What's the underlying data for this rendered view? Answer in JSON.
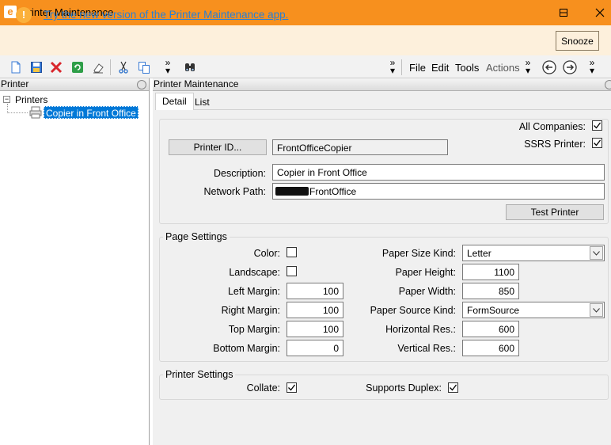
{
  "window": {
    "title": "Printer Maintenance",
    "logo": "e"
  },
  "banner": {
    "link_text": "Try the new version of the Printer Maintenance app.",
    "snooze_label": "Snooze"
  },
  "toolbar": {
    "menus": [
      "File",
      "Edit",
      "Tools",
      "Actions"
    ],
    "icons": [
      "new-icon",
      "save-icon",
      "delete-icon",
      "refresh-icon",
      "clear-icon",
      "cut-icon",
      "copy-icon",
      "more-icon",
      "binoculars-icon",
      "back-icon",
      "forward-icon"
    ]
  },
  "left_pane": {
    "header": "Printer",
    "tree": {
      "root": "Printers",
      "children": [
        "Copier in Front Office"
      ]
    }
  },
  "right_pane": {
    "header": "Printer Maintenance",
    "tabs": [
      "Detail",
      "List"
    ],
    "active_tab": "Detail"
  },
  "detail": {
    "all_companies_label": "All Companies:",
    "all_companies": true,
    "ssrs_label": "SSRS Printer:",
    "ssrs": true,
    "printer_id_button": "Printer ID...",
    "printer_id_value": "FrontOfficeCopier",
    "description_label": "Description:",
    "description_value": "Copier in Front Office",
    "network_path_label": "Network Path:",
    "network_path_value": "FrontOffice",
    "test_printer_button": "Test Printer"
  },
  "page_settings": {
    "title": "Page Settings",
    "color_label": "Color:",
    "color": false,
    "landscape_label": "Landscape:",
    "landscape": false,
    "left_margin_label": "Left Margin:",
    "left_margin": "100",
    "right_margin_label": "Right Margin:",
    "right_margin": "100",
    "top_margin_label": "Top Margin:",
    "top_margin": "100",
    "bottom_margin_label": "Bottom Margin:",
    "bottom_margin": "0",
    "paper_size_kind_label": "Paper Size Kind:",
    "paper_size_kind": "Letter",
    "paper_height_label": "Paper Height:",
    "paper_height": "1100",
    "paper_width_label": "Paper Width:",
    "paper_width": "850",
    "paper_source_kind_label": "Paper Source Kind:",
    "paper_source_kind": "FormSource",
    "horizontal_res_label": "Horizontal Res.:",
    "horizontal_res": "600",
    "vertical_res_label": "Vertical Res.:",
    "vertical_res": "600"
  },
  "printer_settings": {
    "title": "Printer Settings",
    "collate_label": "Collate:",
    "collate": true,
    "duplex_label": "Supports Duplex:",
    "duplex": true
  },
  "colors": {
    "title_bar": "#f7901e",
    "banner_bg": "#fdf0dc",
    "link": "#2a7fd4",
    "selection": "#0078d7"
  }
}
